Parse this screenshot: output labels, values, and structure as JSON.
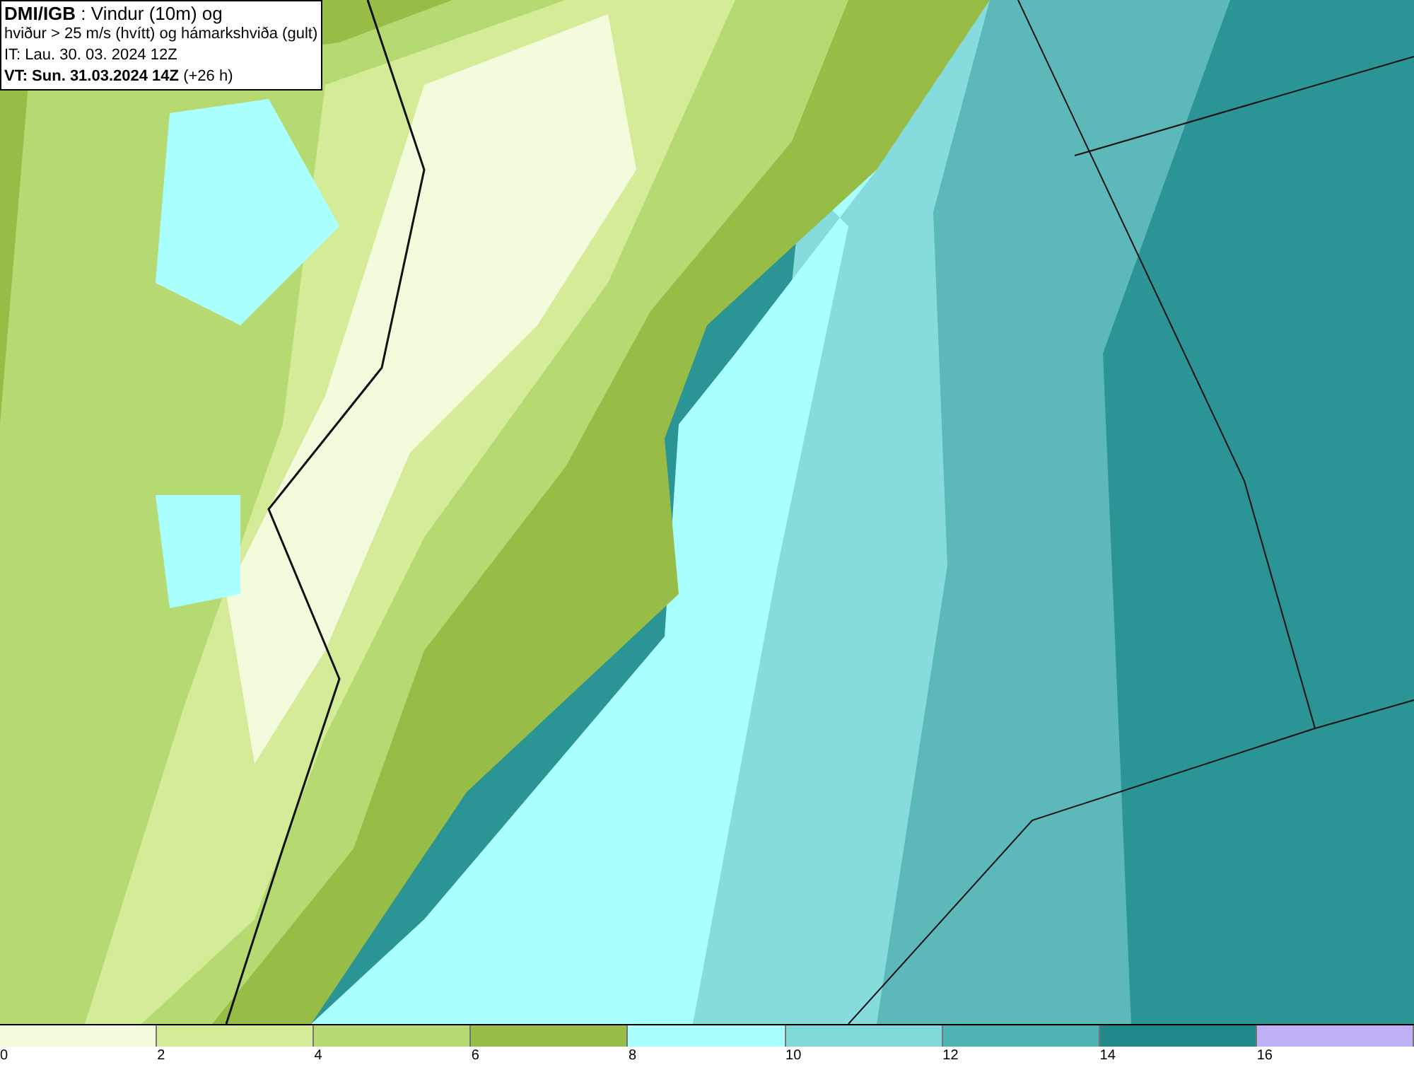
{
  "title_box": {
    "lines": [
      "**DMI/IGB** : Vindur (10m) og",
      "hviður > 25 m/s (hvítt) og hámarkshviða (gult)",
      "IT: Lau. 30. 03. 2024 12Z",
      "**VT: Sun. 31.03.2024 14Z** (+26 h)"
    ]
  },
  "legend": {
    "bins": [
      {
        "label": "0",
        "color": "#f2fbdc"
      },
      {
        "label": "2",
        "color": "#d4eb98"
      },
      {
        "label": "4",
        "color": "#b6da72"
      },
      {
        "label": "6",
        "color": "#97bd46"
      },
      {
        "label": "8",
        "color": "#aaffff"
      },
      {
        "label": "10",
        "color": "#80d9d9"
      },
      {
        "label": "12",
        "color": "#50b3b3"
      },
      {
        "label": "14",
        "color": "#208a8a"
      },
      {
        "label": "16",
        "color": "#c0b0f8"
      }
    ]
  }
}
